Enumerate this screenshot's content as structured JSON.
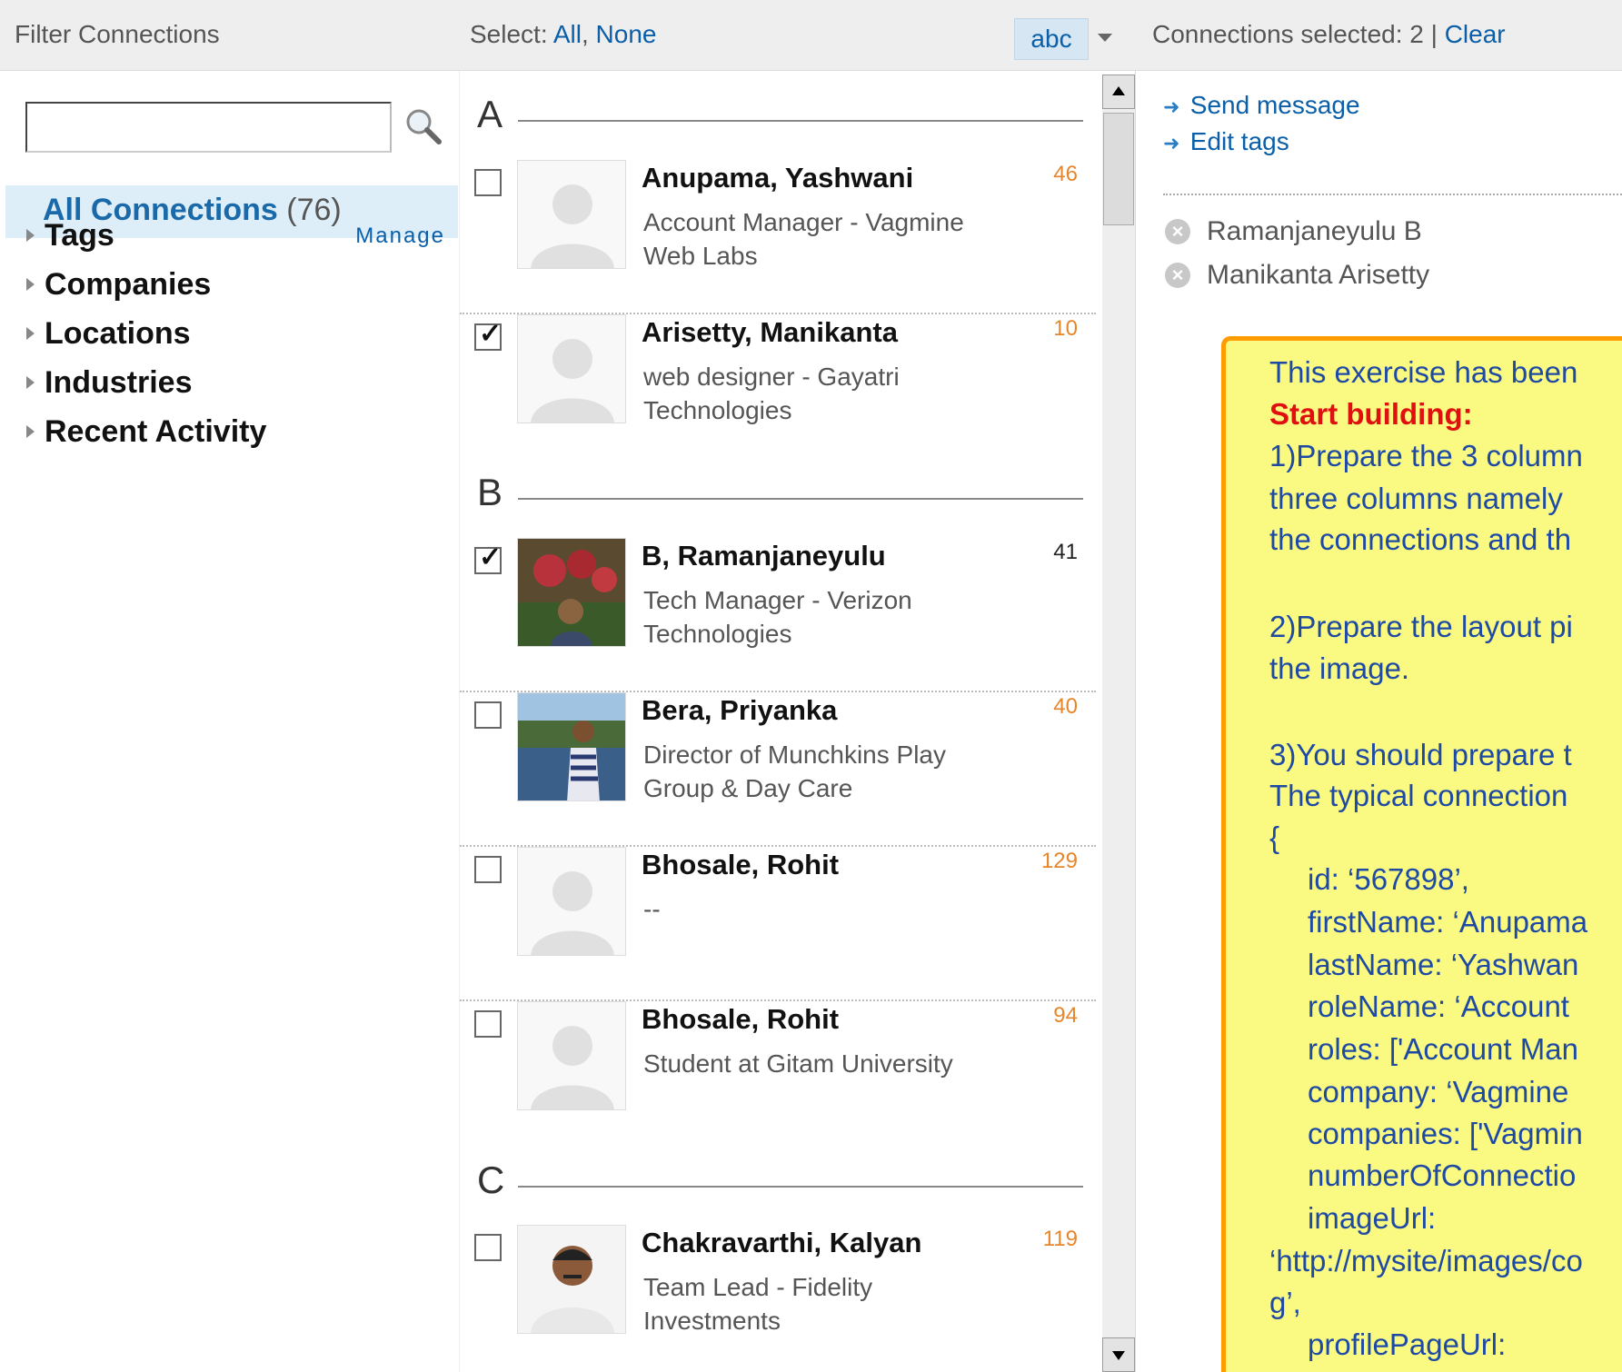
{
  "header": {
    "filter_title": "Filter Connections",
    "select_label": "Select:",
    "select_all": "All",
    "select_sep": ",",
    "select_none": "None",
    "sort_button": "abc",
    "connections_selected_label": "Connections selected: 2 |",
    "clear_label": "Clear"
  },
  "filter": {
    "search_value": "",
    "all_connections_label": "All Connections",
    "all_connections_count": "(76)",
    "nav": [
      {
        "label": "Tags",
        "extra": "Manage"
      },
      {
        "label": "Companies"
      },
      {
        "label": "Locations"
      },
      {
        "label": "Industries"
      },
      {
        "label": "Recent Activity"
      }
    ]
  },
  "list": {
    "sections": [
      "A",
      "B",
      "C"
    ],
    "connections": [
      {
        "name": "Anupama, Yashwani",
        "desc": "Account Manager - Vagmine Web Labs",
        "count": "46",
        "checked": false,
        "count_color": "#e6862b"
      },
      {
        "name": "Arisetty, Manikanta",
        "desc": "web designer - Gayatri Technologies",
        "count": "10",
        "checked": true,
        "count_color": "#e6862b"
      },
      {
        "name": "B, Ramanjaneyulu",
        "desc": "Tech Manager - Verizon Technologies",
        "count": "41",
        "checked": true,
        "count_color": "#222222"
      },
      {
        "name": "Bera, Priyanka",
        "desc": "Director of Munchkins Play Group & Day Care",
        "count": "40",
        "checked": false,
        "count_color": "#e6862b"
      },
      {
        "name": "Bhosale, Rohit",
        "desc": "--",
        "count": "129",
        "checked": false,
        "count_color": "#e6862b"
      },
      {
        "name": "Bhosale, Rohit",
        "desc": "Student at Gitam University",
        "count": "94",
        "checked": false,
        "count_color": "#e6862b"
      },
      {
        "name": "Chakravarthi, Kalyan",
        "desc": "Team Lead - Fidelity Investments",
        "count": "119",
        "checked": false,
        "count_color": "#e6862b"
      }
    ]
  },
  "selected_panel": {
    "actions": [
      "Send message",
      "Edit tags"
    ],
    "selected": [
      "Ramanjaneyulu B",
      "Manikanta Arisetty"
    ]
  },
  "note": {
    "lines": [
      "This exercise has been",
      "Start building:",
      "1)Prepare the 3 column",
      "three columns namely",
      "the connections and th",
      "2)Prepare the layout pi",
      "the image.",
      "3)You should prepare t",
      "The typical connection",
      "{",
      "id: ‘567898’,",
      "firstName: ‘Anupama",
      "lastName: ‘Yashwan",
      "roleName: ‘Account",
      "roles: ['Account Man",
      "company: ‘Vagmine",
      "companies: ['Vagmin",
      "numberOfConnectio",
      "imageUrl:",
      "‘http://mysite/images/co",
      "g’,",
      "profilePageUrl:"
    ]
  }
}
